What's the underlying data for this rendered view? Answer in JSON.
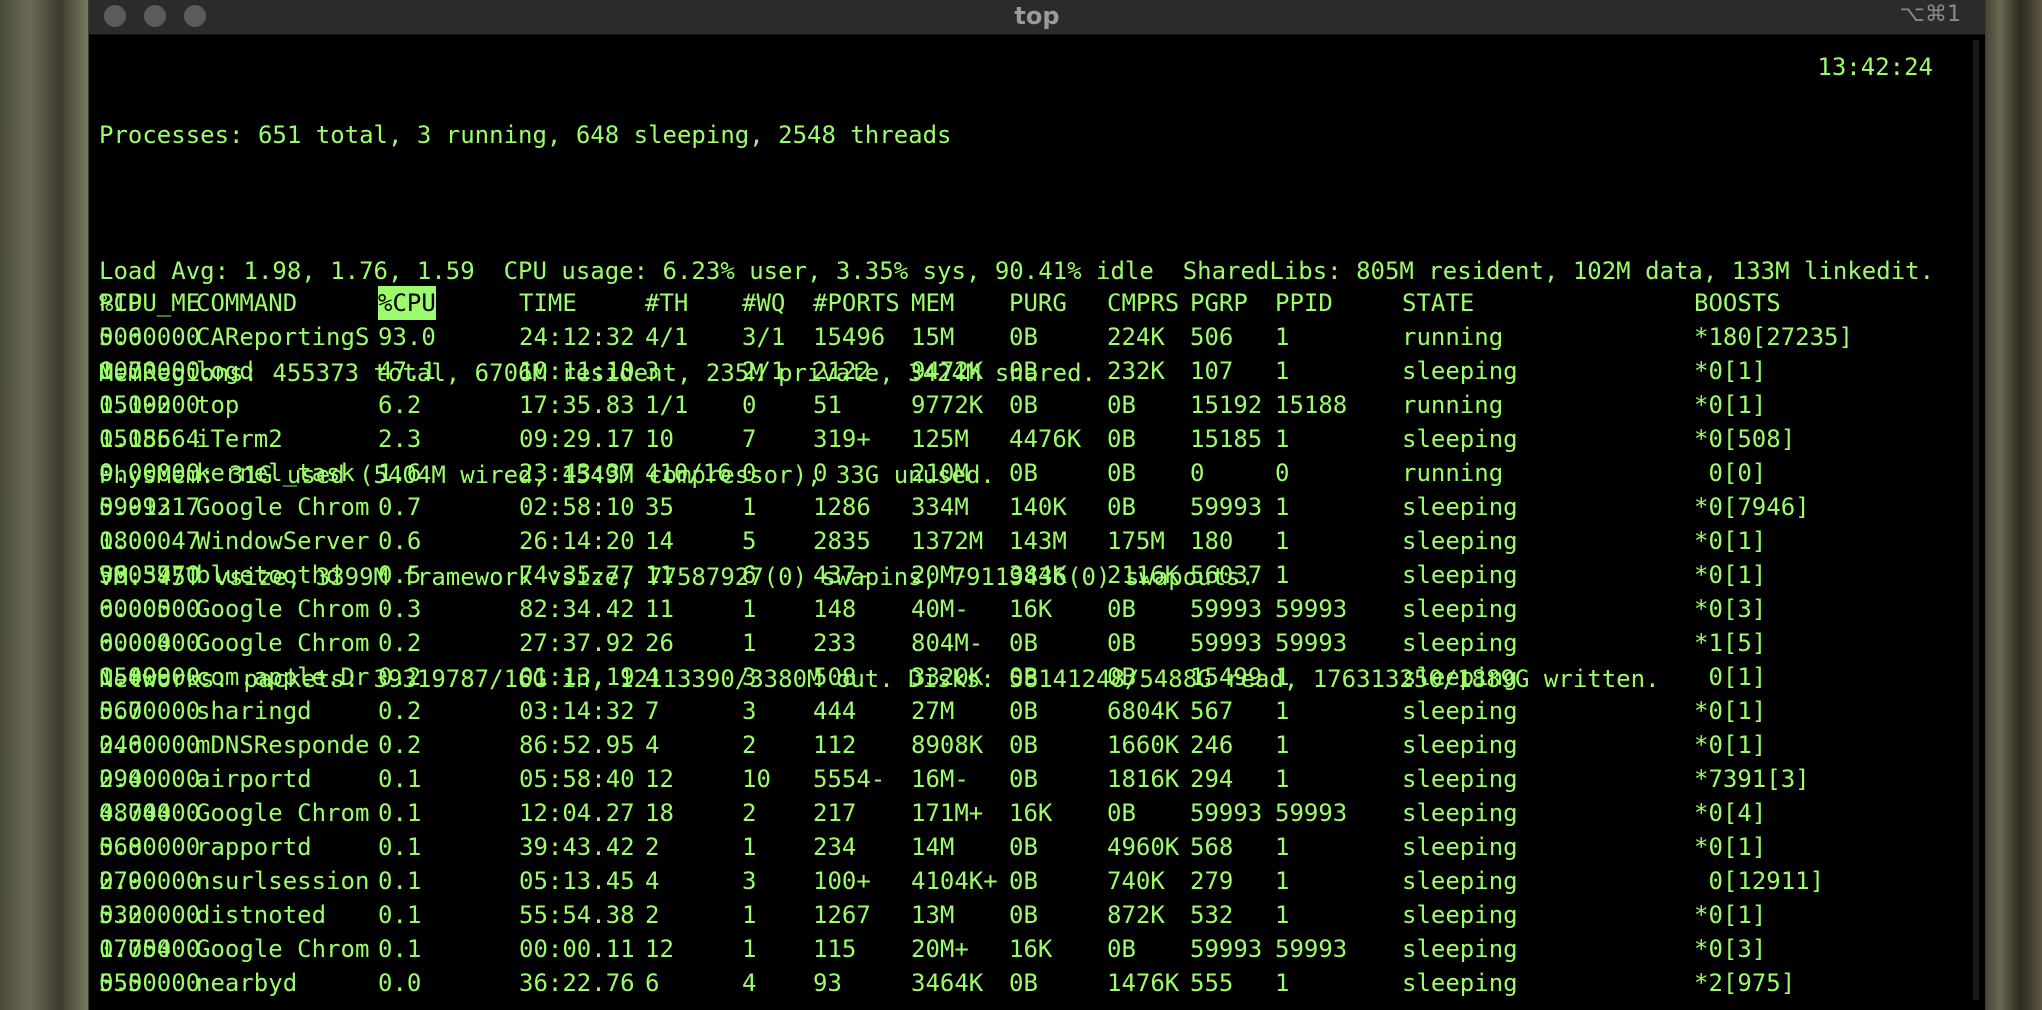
{
  "window": {
    "title": "top",
    "shortcut": "⌥⌘1"
  },
  "summary": {
    "processes": "Processes: 651 total, 3 running, 648 sleeping, 2548 threads",
    "time": "13:42:24",
    "load": "Load Avg: 1.98, 1.76, 1.59  CPU usage: 6.23% user, 3.35% sys, 90.41% idle  SharedLibs: 805M resident, 102M data, 133M linkedit.",
    "memregions": "MemRegions: 455373 total, 6706M resident, 235M private, 3424M shared.",
    "physmem": "PhysMem: 31G used (5404M wired, 1549M compressor), 33G unused.",
    "vm": "VM: 45T vsize, 3399M framework vsize, 77587927(0) swapins, 79119436(0) swapouts.",
    "networks": "Networks: packets: 39319787/16G in, 12113390/3380M out. Disks: 58141248/5488G read, 176313250/1889G written."
  },
  "table": {
    "columns": [
      "PID",
      "COMMAND",
      "%CPU",
      "TIME",
      "#TH",
      "#WQ",
      "#PORTS",
      "MEM",
      "PURG",
      "CMPRS",
      "PGRP",
      "PPID",
      "STATE",
      "BOOSTS",
      "%CPU_ME"
    ],
    "sort_column": "%CPU",
    "rows": [
      [
        "506",
        "CAReportingS",
        "93.0",
        "24:12:32",
        "4/1",
        "3/1",
        "15496",
        "15M",
        "0B",
        "224K",
        "506",
        "1",
        "running",
        "*180[27235]",
        "0.00000"
      ],
      [
        "107",
        "logd",
        "47.1",
        "10:11:10",
        "3",
        "2/1",
        "2122",
        "9472K",
        "0B",
        "232K",
        "107",
        "1",
        "sleeping",
        "*0[1]",
        "0.00000"
      ],
      [
        "15192",
        "top",
        "6.2",
        "17:35.83",
        "1/1",
        "0",
        "51",
        "9772K",
        "0B",
        "0B",
        "15192",
        "15188",
        "running",
        "*0[1]",
        "0.00000"
      ],
      [
        "15185",
        "iTerm2",
        "2.3",
        "09:29.17",
        "10",
        "7",
        "319+",
        "125M",
        "4476K",
        "0B",
        "15185",
        "1",
        "sleeping",
        "*0[508]",
        "0.05664"
      ],
      [
        "0",
        "kernel_task",
        "1.6",
        "23:43:37",
        "410/16",
        "0",
        "0",
        "210M",
        "0B",
        "0B",
        "0",
        "0",
        "running",
        " 0[0]",
        "0.00000"
      ],
      [
        "59993",
        "Google Chrom",
        "0.7",
        "02:58:10",
        "35",
        "1",
        "1286",
        "334M",
        "140K",
        "0B",
        "59993",
        "1",
        "sleeping",
        "*0[7946]",
        "0.01217"
      ],
      [
        "180",
        "WindowServer",
        "0.6",
        "26:14:20",
        "14",
        "5",
        "2835",
        "1372M",
        "143M",
        "175M",
        "180",
        "1",
        "sleeping",
        "*0[1]",
        "0.00047"
      ],
      [
        "56037",
        "bluetoothd",
        "0.5",
        "74:35.77",
        "11",
        "6",
        "437-",
        "20M-",
        "384K",
        "2116K",
        "56037",
        "1",
        "sleeping",
        "*0[1]",
        "93.5970"
      ],
      [
        "60005",
        "Google Chrom",
        "0.3",
        "82:34.42",
        "11",
        "1",
        "148",
        "40M-",
        "16K",
        "0B",
        "59993",
        "59993",
        "sleeping",
        "*0[3]",
        "0.00000"
      ],
      [
        "60004",
        "Google Chrom",
        "0.2",
        "27:37.92",
        "26",
        "1",
        "233",
        "804M-",
        "0B",
        "0B",
        "59993",
        "59993",
        "sleeping",
        "*1[5]",
        "0.00000"
      ],
      [
        "15499",
        "com.apple.Dr",
        "0.2",
        "01:13.19",
        "4",
        "3",
        "508",
        "3320K",
        "0B",
        "0B",
        "15499",
        "1",
        "sleeping",
        " 0[1]",
        "0.00000"
      ],
      [
        "567",
        "sharingd",
        "0.2",
        "03:14:32",
        "7",
        "3",
        "444",
        "27M",
        "0B",
        "6804K",
        "567",
        "1",
        "sleeping",
        "*0[1]",
        "0.00000"
      ],
      [
        "246",
        "mDNSResponde",
        "0.2",
        "86:52.95",
        "4",
        "2",
        "112",
        "8908K",
        "0B",
        "1660K",
        "246",
        "1",
        "sleeping",
        "*0[1]",
        "0.00000"
      ],
      [
        "294",
        "airportd",
        "0.1",
        "05:58:40",
        "12",
        "10",
        "5554-",
        "16M-",
        "0B",
        "1816K",
        "294",
        "1",
        "sleeping",
        "*7391[3]",
        "0.00000"
      ],
      [
        "48744",
        "Google Chrom",
        "0.1",
        "12:04.27",
        "18",
        "2",
        "217",
        "171M+",
        "16K",
        "0B",
        "59993",
        "59993",
        "sleeping",
        "*0[4]",
        "0.00000"
      ],
      [
        "568",
        "rapportd",
        "0.1",
        "39:43.42",
        "2",
        "1",
        "234",
        "14M",
        "0B",
        "4960K",
        "568",
        "1",
        "sleeping",
        "*0[1]",
        "0.00000"
      ],
      [
        "279",
        "nsurlsession",
        "0.1",
        "05:13.45",
        "4",
        "3",
        "100+",
        "4104K+",
        "0B",
        "740K",
        "279",
        "1",
        "sleeping",
        " 0[12911]",
        "0.00000"
      ],
      [
        "532",
        "distnoted",
        "0.1",
        "55:54.38",
        "2",
        "1",
        "1267",
        "13M",
        "0B",
        "872K",
        "532",
        "1",
        "sleeping",
        "*0[1]",
        "0.00000"
      ],
      [
        "17754",
        "Google Chrom",
        "0.1",
        "00:00.11",
        "12",
        "1",
        "115",
        "20M+",
        "16K",
        "0B",
        "59993",
        "59993",
        "sleeping",
        "*0[3]",
        "0.00000"
      ],
      [
        "555",
        "nearbyd",
        "0.0",
        "36:22.76",
        "6",
        "4",
        "93",
        "3464K",
        "0B",
        "1476K",
        "555",
        "1",
        "sleeping",
        "*2[975]",
        "0.00000"
      ]
    ]
  },
  "colors": {
    "terminal_fg": "#9dfc6b",
    "terminal_bg": "#000000",
    "titlebar": "#2b2b2b"
  }
}
